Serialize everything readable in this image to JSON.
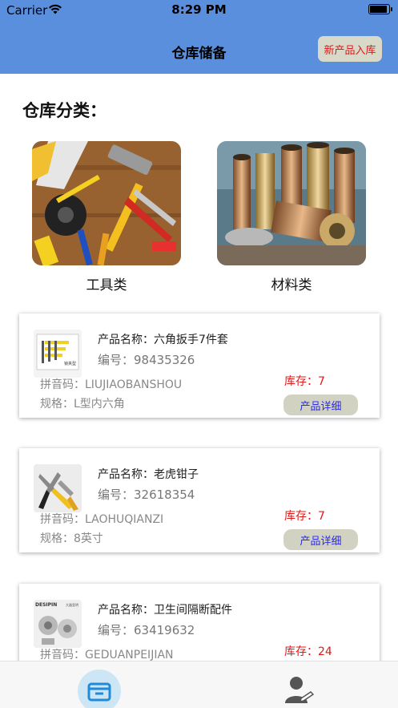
{
  "status": {
    "carrier": "Carrier",
    "time": "8:29 PM"
  },
  "nav": {
    "title": "仓库储备",
    "new_button": "新产品入库"
  },
  "section_title": "仓库分类：",
  "categories": [
    {
      "label": "工具类"
    },
    {
      "label": "材料类"
    }
  ],
  "products": [
    {
      "name": "产品名称：六角扳手7件套",
      "code": "编号：98435326",
      "pinyin": "拼音码：LIUJIAOBANSHOU",
      "spec": "规格：L型内六角",
      "stock": "库存：7",
      "detail": "产品详细"
    },
    {
      "name": "产品名称：老虎钳子",
      "code": "编号：32618354",
      "pinyin": "拼音码：LAOHUQIANZI",
      "spec": "规格：8英寸",
      "stock": "库存：7",
      "detail": "产品详细"
    },
    {
      "name": "产品名称：卫生间隔断配件",
      "code": "编号：63419632",
      "pinyin": "拼音码：GEDUANPEIJIAN",
      "spec": "",
      "stock": "库存：24",
      "detail": ""
    }
  ],
  "thumb_text": {
    "hex_label": "锁夹型",
    "brand": "DESIPIN",
    "brand_cn": "大器皇明"
  },
  "colors": {
    "nav_bg": "#5a8fdd",
    "accent_red": "#e01818",
    "detail_text": "#2a2aee",
    "tab_active_bg": "#cde6f6"
  },
  "icons": {
    "home_tab": "warehouse-box-icon",
    "user_tab": "user-edit-icon"
  }
}
